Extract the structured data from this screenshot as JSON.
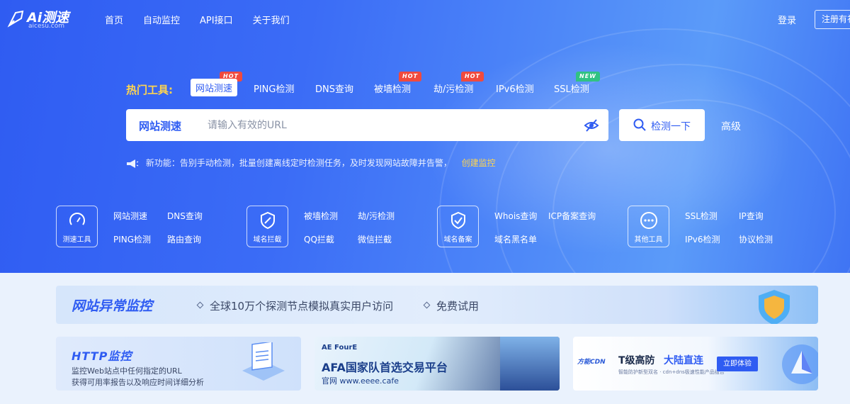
{
  "header": {
    "logo_main": "Ai测速",
    "logo_sub": "aicesu.com",
    "nav": [
      "首页",
      "自动监控",
      "API接口",
      "关于我们"
    ],
    "login": "登录",
    "register": "注册有礼"
  },
  "tools": {
    "label": "热门工具:",
    "tabs": [
      {
        "label": "网站测速",
        "badge": "HOT"
      },
      {
        "label": "PING检测",
        "badge": ""
      },
      {
        "label": "DNS查询",
        "badge": ""
      },
      {
        "label": "被墙检测",
        "badge": "HOT"
      },
      {
        "label": "劫/污检测",
        "badge": "HOT"
      },
      {
        "label": "IPv6检测",
        "badge": ""
      },
      {
        "label": "SSL检测",
        "badge": "NEW"
      }
    ]
  },
  "search": {
    "type_label": "网站测速",
    "placeholder": "请输入有效的URL",
    "value": "",
    "submit_label": "检测一下",
    "advanced_label": "高级"
  },
  "announce": {
    "text": "新功能：告别手动检测，批量创建离线定时检测任务，及时发现网站故障并告警，",
    "link": "创建监控"
  },
  "categories": [
    {
      "caption": "测速工具",
      "icon": "speedometer-icon",
      "links": [
        "网站测速",
        "DNS查询",
        "PING检测",
        "路由查询"
      ]
    },
    {
      "caption": "域名拦截",
      "icon": "shield-slash-icon",
      "links": [
        "被墙检测",
        "劫/污检测",
        "QQ拦截",
        "微信拦截"
      ]
    },
    {
      "caption": "域名备案",
      "icon": "shield-check-icon",
      "links": [
        "Whois查询",
        "ICP备案查询",
        "域名黑名单"
      ]
    },
    {
      "caption": "其他工具",
      "icon": "more-dots-icon",
      "links": [
        "SSL检测",
        "IP查询",
        "IPv6检测",
        "协议检测"
      ]
    }
  ],
  "banner": {
    "title": "网站异常监控",
    "features": [
      "全球10万个探测节点模拟真实用户访问",
      "免费试用"
    ]
  },
  "cards": {
    "http": {
      "title": "HTTP监控",
      "line1": "监控Web站点中任何指定的URL",
      "line2": "获得可用率报告以及响应时间详细分析"
    },
    "afa": {
      "brand": "AE FourE",
      "title": "AFA国家队首选交易平台",
      "url": "官网 www.eeee.cafe"
    },
    "cdn": {
      "logo": "方能CDN",
      "title_a": "T级高防",
      "title_b": "大陆直连",
      "sub": "智能防护新型双名 · cdn+dns极速性能产品组合",
      "button": "立即体验"
    }
  },
  "colors": {
    "primary": "#2f5cf2",
    "hot": "#f04a3e",
    "new": "#31c283",
    "highlight": "#ffd54f"
  }
}
